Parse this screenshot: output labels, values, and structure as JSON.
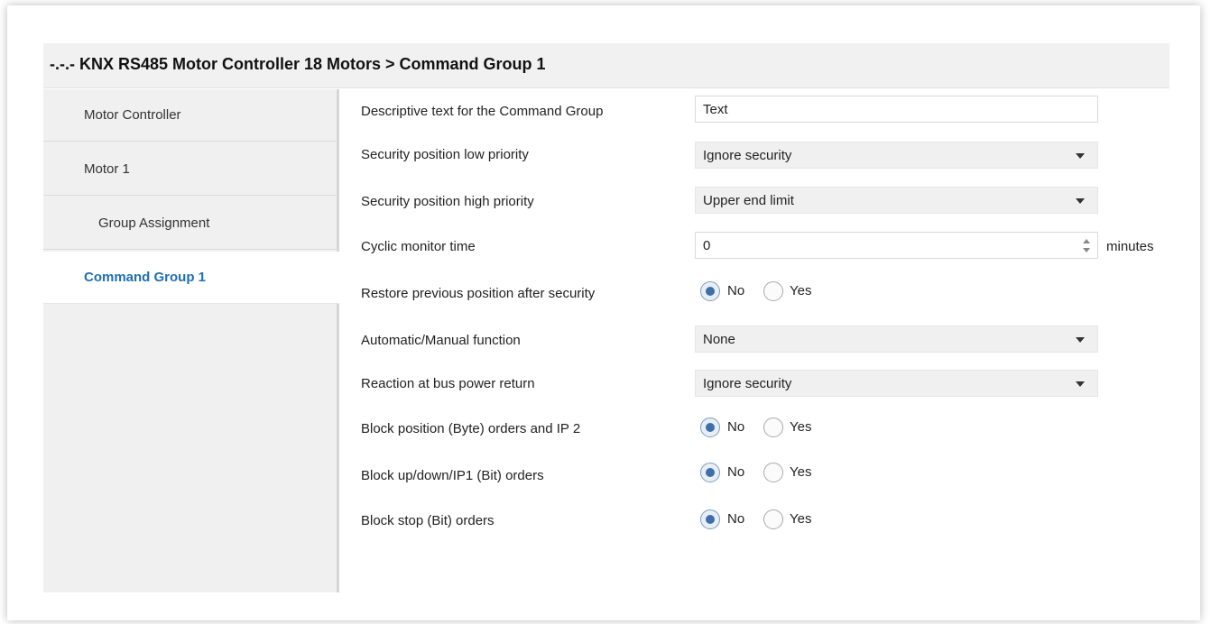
{
  "header": {
    "title": "-.-.- KNX RS485 Motor Controller 18 Motors > Command Group 1"
  },
  "sidebar": {
    "items": [
      {
        "label": "Motor Controller"
      },
      {
        "label": "Motor 1"
      },
      {
        "label": "Group Assignment"
      },
      {
        "label": "Command Group 1",
        "active": true
      }
    ]
  },
  "params": {
    "descriptive_text": {
      "label": "Descriptive text for the Command Group",
      "value": "Text"
    },
    "sec_low": {
      "label": "Security position low priority",
      "value": "Ignore security"
    },
    "sec_high": {
      "label": "Security position high priority",
      "value": "Upper end limit"
    },
    "cyclic": {
      "label": "Cyclic monitor time",
      "value": "0",
      "unit": "minutes"
    },
    "restore": {
      "label": "Restore previous position after security",
      "no": "No",
      "yes": "Yes",
      "selected": "No"
    },
    "auto_manual": {
      "label": "Automatic/Manual function",
      "value": "None"
    },
    "bus_return": {
      "label": "Reaction at bus power return",
      "value": "Ignore security"
    },
    "block_byte": {
      "label": "Block position (Byte) orders and IP 2",
      "no": "No",
      "yes": "Yes",
      "selected": "No"
    },
    "block_updown": {
      "label": "Block up/down/IP1 (Bit) orders",
      "no": "No",
      "yes": "Yes",
      "selected": "No"
    },
    "block_stop": {
      "label": "Block stop (Bit) orders",
      "no": "No",
      "yes": "Yes",
      "selected": "No"
    }
  },
  "colors": {
    "accent": "#1f6fb2",
    "radio_selected": "#3f6fa8"
  }
}
